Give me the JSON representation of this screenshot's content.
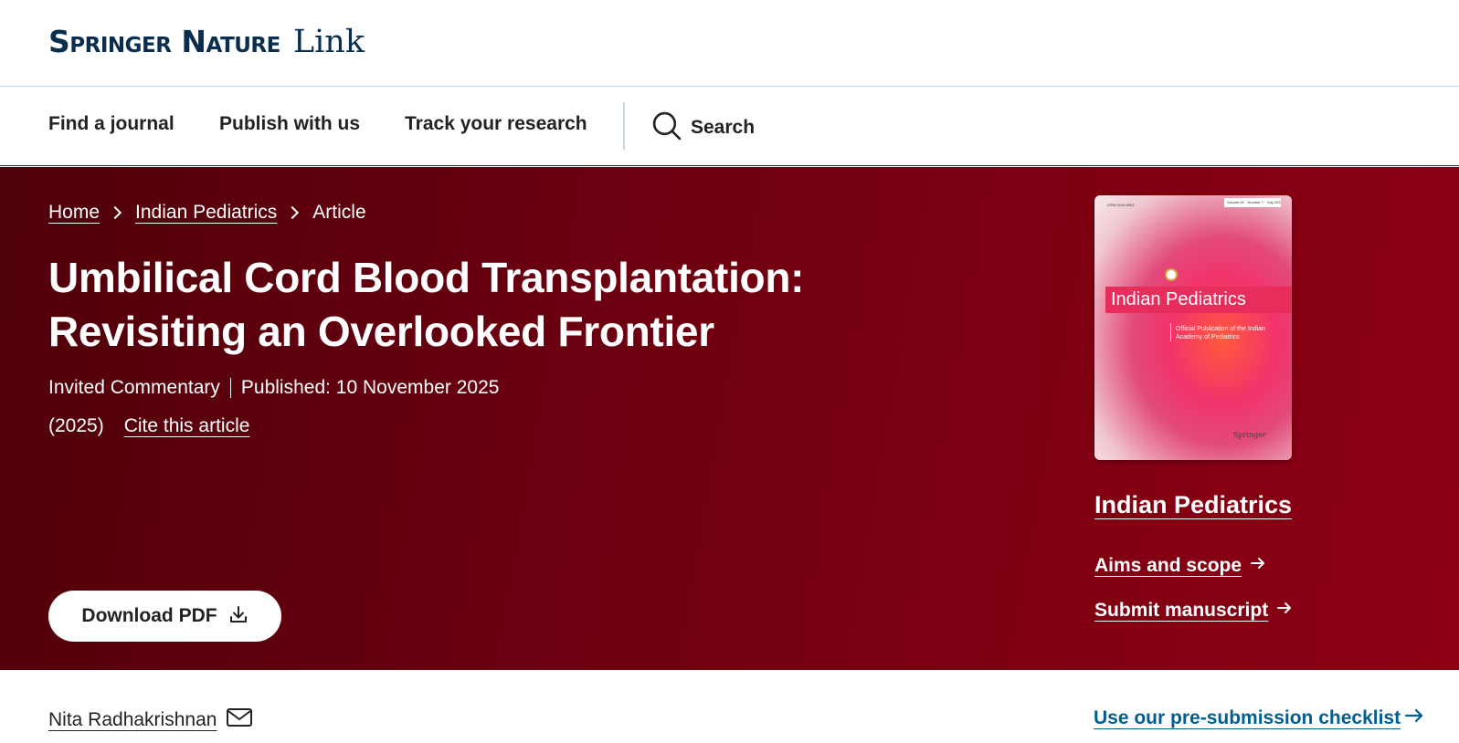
{
  "brand": {
    "name": "Springer Nature",
    "product": "Link"
  },
  "nav": {
    "items": [
      "Find a journal",
      "Publish with us",
      "Track your research"
    ],
    "search_label": "Search"
  },
  "breadcrumb": {
    "home": "Home",
    "journal": "Indian Pediatrics",
    "current": "Article"
  },
  "article": {
    "title_line1": "Umbilical Cord Blood Transplantation:",
    "title_line2": "Revisiting an Overlooked Frontier",
    "type": "Invited Commentary",
    "published": "Published: 10 November 2025",
    "year": "(2025)",
    "cite_label": "Cite this article",
    "download_label": "Download PDF"
  },
  "cover": {
    "issn": "ISSN 0019-6061",
    "volume": "Volume 62 · Number 7 · July 2025",
    "title": "Indian Pediatrics",
    "subtitle": "Official Publication of the Indian Academy of Pediatrics",
    "publisher": "Springer"
  },
  "journal_panel": {
    "name": "Indian Pediatrics",
    "links": [
      "Aims and scope",
      "Submit manuscript"
    ]
  },
  "author": {
    "name": "Nita Radhakrishnan"
  },
  "checklist_label": "Use our pre-submission checklist",
  "colors": {
    "hero_start": "#4f000a",
    "hero_end": "#8e0014",
    "brand_navy": "#0c2e4e",
    "link_blue": "#025e8d"
  }
}
